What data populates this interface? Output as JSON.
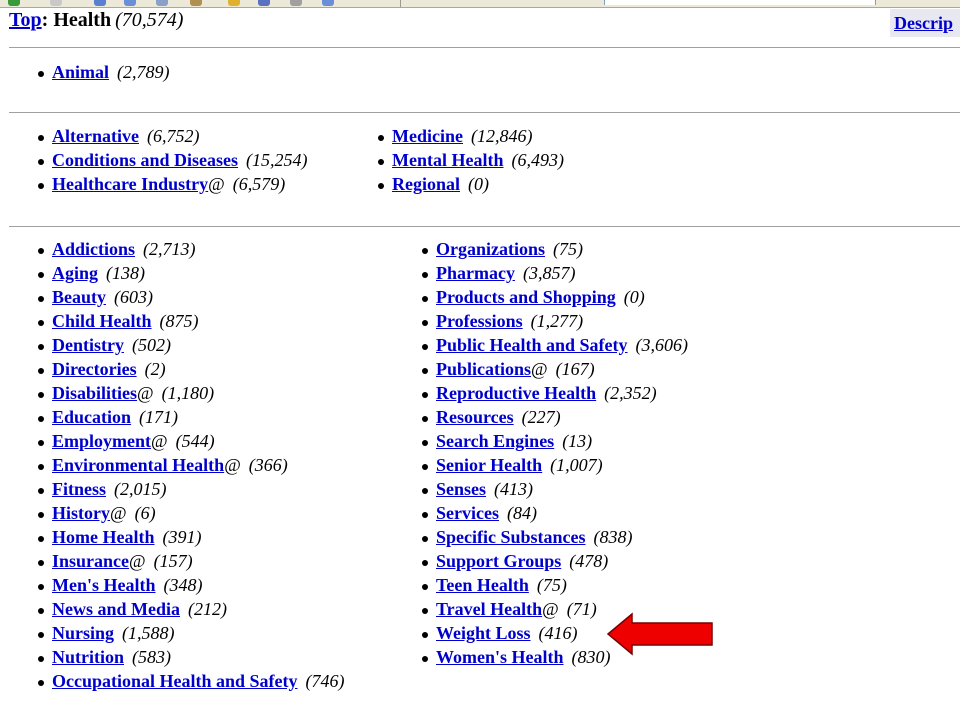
{
  "header": {
    "top_link": "Top",
    "separator": ": ",
    "current": "Health",
    "count": "(70,574)",
    "description_link": "Descrip"
  },
  "sections": [
    {
      "name": "special",
      "columns": [
        [
          {
            "label": "Animal",
            "suffix": "",
            "count": "(2,789)"
          }
        ]
      ]
    },
    {
      "name": "related",
      "columns": [
        [
          {
            "label": "Alternative",
            "suffix": "",
            "count": "(6,752)"
          },
          {
            "label": "Conditions and Diseases",
            "suffix": "",
            "count": "(15,254)"
          },
          {
            "label": "Healthcare Industry",
            "suffix": "@",
            "count": "(6,579)"
          }
        ],
        [
          {
            "label": "Medicine",
            "suffix": "",
            "count": "(12,846)"
          },
          {
            "label": "Mental Health",
            "suffix": "",
            "count": "(6,493)"
          },
          {
            "label": "Regional",
            "suffix": "",
            "count": "(0)"
          }
        ]
      ]
    },
    {
      "name": "subcategories",
      "columns": [
        [
          {
            "label": "Addictions",
            "suffix": "",
            "count": "(2,713)"
          },
          {
            "label": "Aging",
            "suffix": "",
            "count": "(138)"
          },
          {
            "label": "Beauty",
            "suffix": "",
            "count": "(603)"
          },
          {
            "label": "Child Health",
            "suffix": "",
            "count": "(875)"
          },
          {
            "label": "Dentistry",
            "suffix": "",
            "count": "(502)"
          },
          {
            "label": "Directories",
            "suffix": "",
            "count": "(2)"
          },
          {
            "label": "Disabilities",
            "suffix": "@",
            "count": "(1,180)"
          },
          {
            "label": "Education",
            "suffix": "",
            "count": "(171)"
          },
          {
            "label": "Employment",
            "suffix": "@",
            "count": "(544)"
          },
          {
            "label": "Environmental Health",
            "suffix": "@",
            "count": "(366)"
          },
          {
            "label": "Fitness",
            "suffix": "",
            "count": "(2,015)"
          },
          {
            "label": "History",
            "suffix": "@",
            "count": "(6)"
          },
          {
            "label": "Home Health",
            "suffix": "",
            "count": "(391)"
          },
          {
            "label": "Insurance",
            "suffix": "@",
            "count": "(157)"
          },
          {
            "label": "Men's Health",
            "suffix": "",
            "count": "(348)"
          },
          {
            "label": "News and Media",
            "suffix": "",
            "count": "(212)"
          },
          {
            "label": "Nursing",
            "suffix": "",
            "count": "(1,588)"
          },
          {
            "label": "Nutrition",
            "suffix": "",
            "count": "(583)"
          },
          {
            "label": "Occupational Health and Safety",
            "suffix": "",
            "count": "(746)"
          }
        ],
        [
          {
            "label": "Organizations",
            "suffix": "",
            "count": "(75)"
          },
          {
            "label": "Pharmacy",
            "suffix": "",
            "count": "(3,857)"
          },
          {
            "label": "Products and Shopping",
            "suffix": "",
            "count": "(0)"
          },
          {
            "label": "Professions",
            "suffix": "",
            "count": "(1,277)"
          },
          {
            "label": "Public Health and Safety",
            "suffix": "",
            "count": "(3,606)"
          },
          {
            "label": "Publications",
            "suffix": "@",
            "count": "(167)"
          },
          {
            "label": "Reproductive Health",
            "suffix": "",
            "count": "(2,352)"
          },
          {
            "label": "Resources",
            "suffix": "",
            "count": "(227)"
          },
          {
            "label": "Search Engines",
            "suffix": "",
            "count": "(13)"
          },
          {
            "label": "Senior Health",
            "suffix": "",
            "count": "(1,007)"
          },
          {
            "label": "Senses",
            "suffix": "",
            "count": "(413)"
          },
          {
            "label": "Services",
            "suffix": "",
            "count": "(84)"
          },
          {
            "label": "Specific Substances",
            "suffix": "",
            "count": "(838)"
          },
          {
            "label": "Support Groups",
            "suffix": "",
            "count": "(478)"
          },
          {
            "label": "Teen Health",
            "suffix": "",
            "count": "(75)"
          },
          {
            "label": "Travel Health",
            "suffix": "@",
            "count": "(71)"
          },
          {
            "label": "Weight Loss",
            "suffix": "",
            "count": "(416)"
          },
          {
            "label": "Women's Health",
            "suffix": "",
            "count": "(830)"
          }
        ]
      ]
    }
  ],
  "annotation": {
    "arrow_color": "#ee0000",
    "arrow_target": "Weight Loss"
  },
  "colors": {
    "link": "#0000cc",
    "rule": "#a0a0a0",
    "description_box": "#e8e8f0"
  }
}
